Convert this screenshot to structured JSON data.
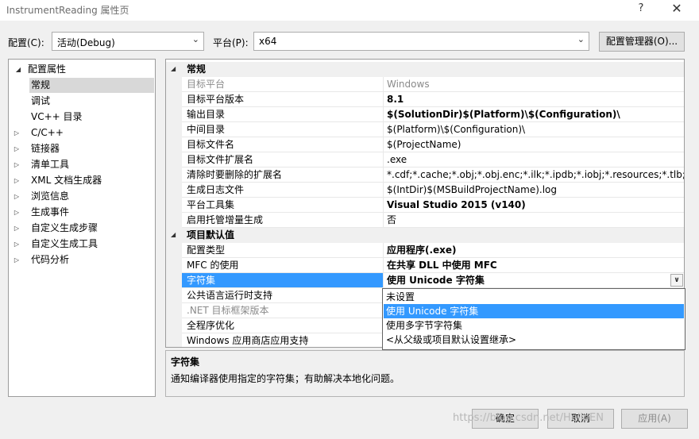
{
  "window": {
    "title": "InstrumentReading 属性页",
    "help_glyph": "?",
    "close_glyph": "✕"
  },
  "toolbar": {
    "config_label": "配置(C):",
    "config_value": "活动(Debug)",
    "platform_label": "平台(P):",
    "platform_value": "x64",
    "config_manager_label": "配置管理器(O)..."
  },
  "tree": {
    "root": "配置属性",
    "items": [
      {
        "label": "常规",
        "expandable": false,
        "selected": true
      },
      {
        "label": "调试",
        "expandable": false
      },
      {
        "label": "VC++ 目录",
        "expandable": false
      },
      {
        "label": "C/C++",
        "expandable": true
      },
      {
        "label": "链接器",
        "expandable": true
      },
      {
        "label": "清单工具",
        "expandable": true
      },
      {
        "label": "XML 文档生成器",
        "expandable": true
      },
      {
        "label": "浏览信息",
        "expandable": true
      },
      {
        "label": "生成事件",
        "expandable": true
      },
      {
        "label": "自定义生成步骤",
        "expandable": true
      },
      {
        "label": "自定义生成工具",
        "expandable": true
      },
      {
        "label": "代码分析",
        "expandable": true
      }
    ]
  },
  "grid": {
    "sections": [
      {
        "title": "常规",
        "rows": [
          {
            "name": "目标平台",
            "value": "Windows",
            "disabled": true
          },
          {
            "name": "目标平台版本",
            "value": "8.1",
            "bold": true
          },
          {
            "name": "输出目录",
            "value": "$(SolutionDir)$(Platform)\\$(Configuration)\\",
            "bold": true
          },
          {
            "name": "中间目录",
            "value": "$(Platform)\\$(Configuration)\\"
          },
          {
            "name": "目标文件名",
            "value": "$(ProjectName)"
          },
          {
            "name": "目标文件扩展名",
            "value": ".exe"
          },
          {
            "name": "清除时要删除的扩展名",
            "value": "*.cdf;*.cache;*.obj;*.obj.enc;*.ilk;*.ipdb;*.iobj;*.resources;*.tlb;*.tli;*.t"
          },
          {
            "name": "生成日志文件",
            "value": "$(IntDir)$(MSBuildProjectName).log"
          },
          {
            "name": "平台工具集",
            "value": "Visual Studio 2015 (v140)",
            "bold": true
          },
          {
            "name": "启用托管增量生成",
            "value": "否"
          }
        ]
      },
      {
        "title": "项目默认值",
        "rows": [
          {
            "name": "配置类型",
            "value": "应用程序(.exe)",
            "bold": true
          },
          {
            "name": "MFC 的使用",
            "value": "在共享 DLL 中使用 MFC",
            "bold": true
          },
          {
            "name": "字符集",
            "value": "使用 Unicode 字符集",
            "bold": true,
            "selected": true
          },
          {
            "name": "公共语言运行时支持",
            "value": ""
          },
          {
            "name": ".NET 目标框架版本",
            "value": "",
            "disabled": true
          },
          {
            "name": "全程序优化",
            "value": ""
          },
          {
            "name": "Windows 应用商店应用支持",
            "value": ""
          }
        ]
      }
    ]
  },
  "dropdown": {
    "options": [
      {
        "label": "未设置"
      },
      {
        "label": "使用 Unicode 字符集",
        "highlighted": true
      },
      {
        "label": "使用多字节字符集"
      },
      {
        "label": "<从父级或项目默认设置继承>"
      }
    ]
  },
  "description": {
    "title": "字符集",
    "text": "通知编译器使用指定的字符集；有助解决本地化问题。"
  },
  "buttons": {
    "ok": "确定",
    "cancel": "取消",
    "apply": "应用(A)"
  },
  "watermark": "https://blog.csdn.net/HelloEN",
  "colors": {
    "selection": "#3399ff",
    "background": "#f0f0f0"
  }
}
